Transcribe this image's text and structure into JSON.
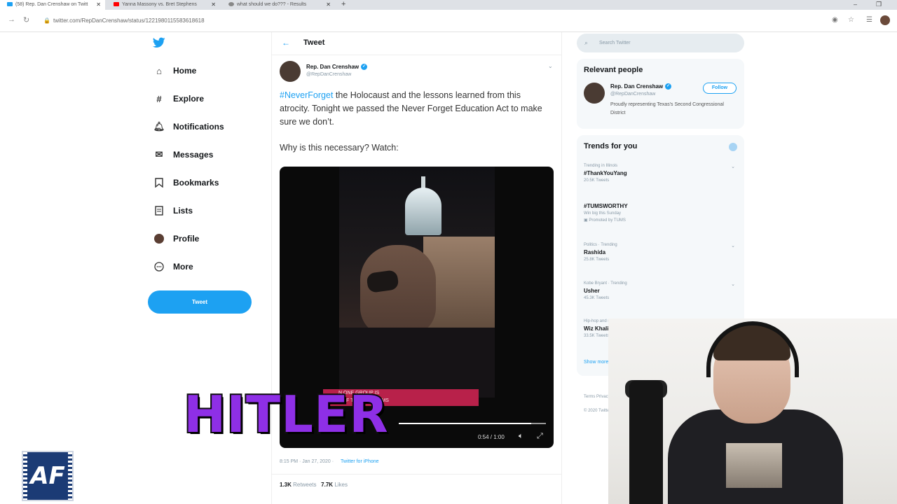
{
  "browser": {
    "tabs": [
      {
        "title": "(58) Rep. Dan Crenshaw on Twitt",
        "color": "#1da1f2"
      },
      {
        "title": "Yanna Massony vs. Bret Stephens",
        "color": "#ff0000"
      },
      {
        "title": "what should we do??? - Results",
        "color": "#888888"
      }
    ],
    "url": "twitter.com/RepDanCrenshaw/status/1221980115583618618"
  },
  "nav": {
    "items": [
      {
        "label": "Home",
        "icon": "home-icon"
      },
      {
        "label": "Explore",
        "icon": "hashtag-icon"
      },
      {
        "label": "Notifications",
        "icon": "bell-icon"
      },
      {
        "label": "Messages",
        "icon": "envelope-icon"
      },
      {
        "label": "Bookmarks",
        "icon": "bookmark-icon"
      },
      {
        "label": "Lists",
        "icon": "list-icon"
      },
      {
        "label": "Profile",
        "icon": "avatar-icon"
      },
      {
        "label": "More",
        "icon": "more-icon"
      }
    ],
    "tweet_button": "Tweet"
  },
  "header": {
    "title": "Tweet"
  },
  "tweet": {
    "author_name": "Rep. Dan Crenshaw",
    "author_handle": "@RepDanCrenshaw",
    "hashtag": "#NeverForget",
    "text_rest": " the Holocaust and the lessons learned from this atrocity. Tonight we passed the Never Forget Education Act to make sure we don’t.",
    "text_second": "Why is this necessary? Watch:",
    "video": {
      "caption_line1": "N ONE GROUP IS",
      "caption_line2": "L OF THE PROBLEMS",
      "time": "0:54 / 1:00",
      "progress": 0.9
    },
    "timestamp": "8:15 PM · Jan 27, 2020 ·",
    "source": "Twitter for iPhone",
    "retweets_count": "1.3K",
    "retweets_label": "Retweets",
    "likes_count": "7.7K",
    "likes_label": "Likes"
  },
  "right": {
    "search_placeholder": "Search Twitter",
    "relevant_title": "Relevant people",
    "relevant_name": "Rep. Dan Crenshaw",
    "relevant_handle": "@RepDanCrenshaw",
    "relevant_bio": "Proudly representing Texas's Second Congressional District",
    "follow_label": "Follow",
    "trends_title": "Trends for you",
    "trends": [
      {
        "context": "Trending in Illinois",
        "name": "#ThankYouYang",
        "count": "20.5K Tweets"
      },
      {
        "context": "",
        "name": "#TUMSWORTHY",
        "count": "Win big this Sunday",
        "promo": "Promoted by TUMS"
      },
      {
        "context": "Politics · Trending",
        "name": "Rashida",
        "count": "25.8K Tweets"
      },
      {
        "context": "Kobe Bryant · Trending",
        "name": "Usher",
        "count": "45.3K Tweets"
      },
      {
        "context": "Hip-hop and rap · Trending",
        "name": "Wiz Khalifa",
        "count": "33.5K Tweets"
      }
    ],
    "show_more": "Show more",
    "footer_line1": "Terms   Privacy policy   Cookies   Ads info",
    "footer_line2": "© 2020 Twitter, Inc."
  },
  "overlay": {
    "big_text": "HITLER",
    "logo_text": "AF"
  }
}
